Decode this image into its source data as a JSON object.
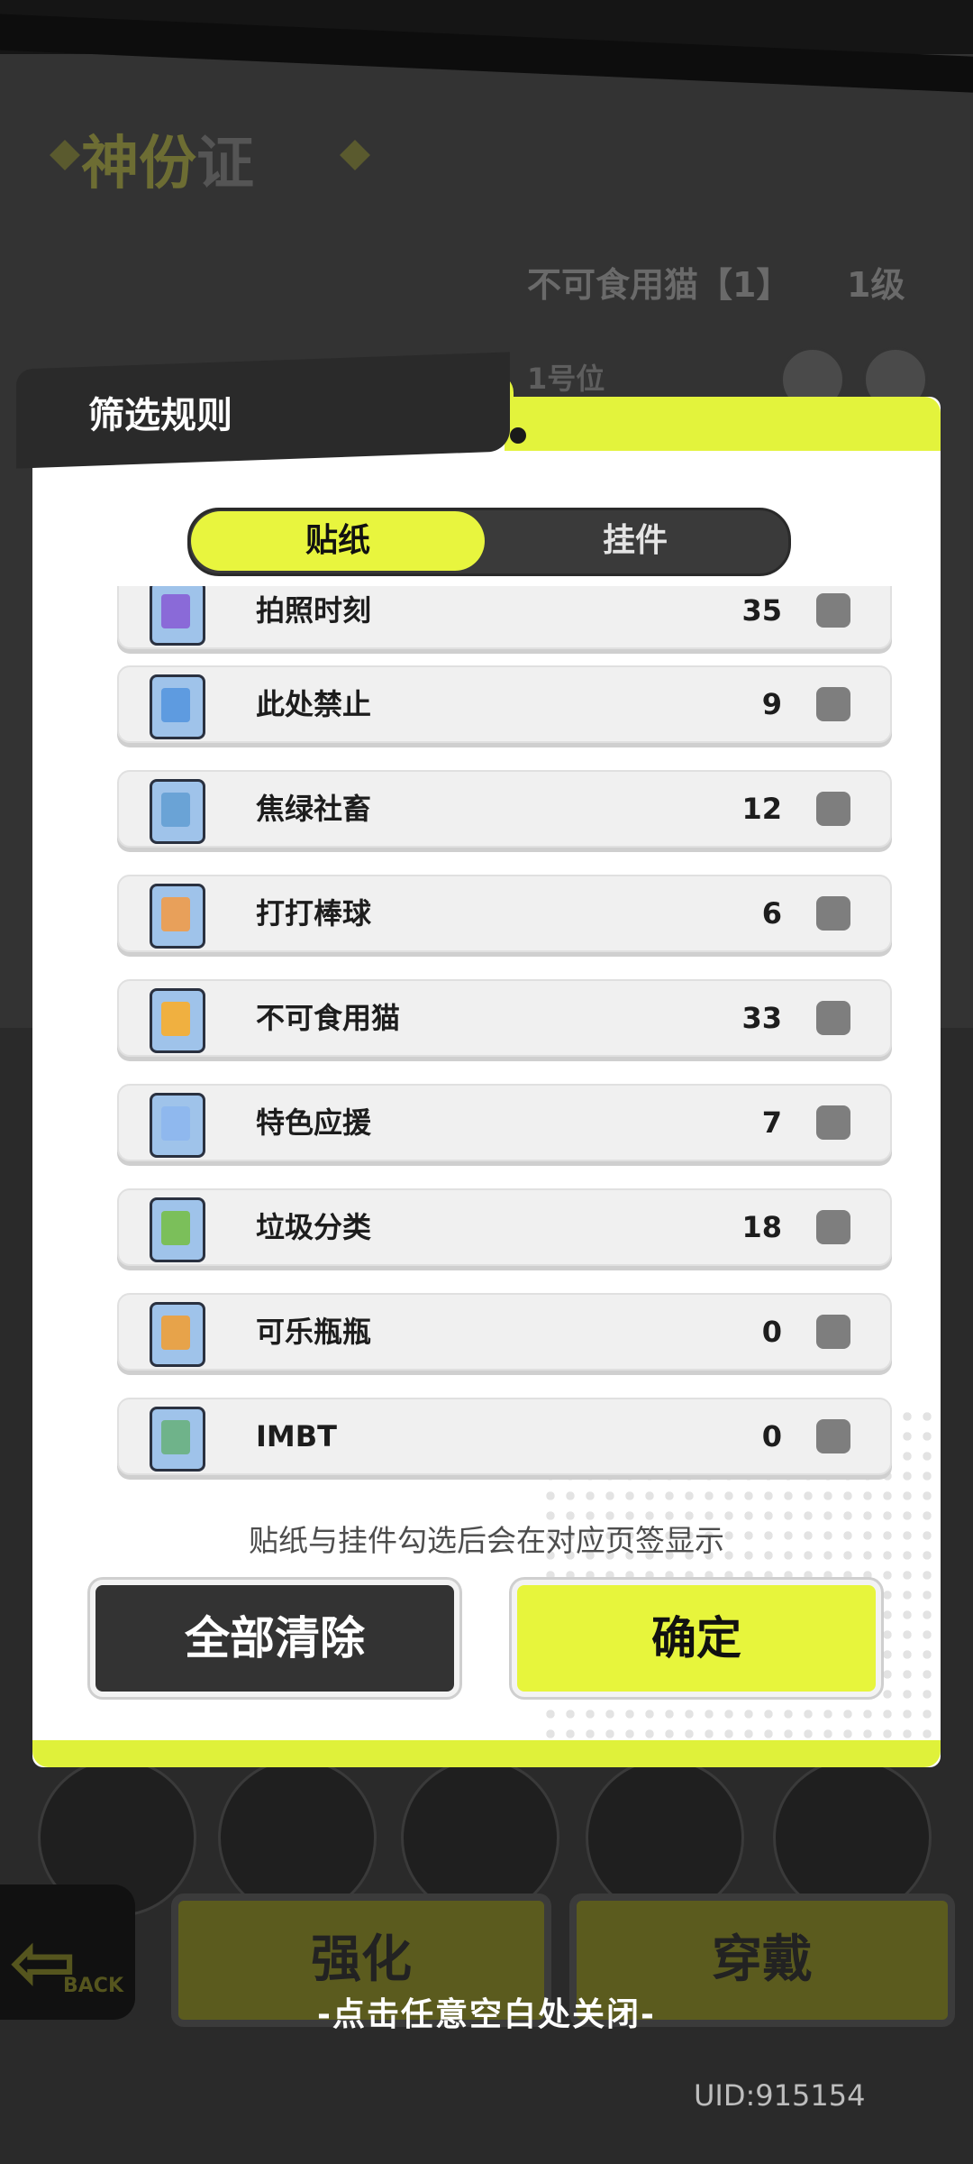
{
  "background": {
    "title_part1": "神份",
    "title_part2": "证",
    "character_name": "不可食用猫【1】",
    "level": "1级",
    "slot": "1号位",
    "back_label": "BACK",
    "enhance_button": "强化",
    "wear_button": "穿戴"
  },
  "modal": {
    "title": "筛选规则",
    "tabs": [
      {
        "label": "贴纸",
        "active": true
      },
      {
        "label": "挂件",
        "active": false
      }
    ],
    "items": [
      {
        "name": "拍照时刻",
        "count": "35",
        "icon_color": "#8a6ad8"
      },
      {
        "name": "此处禁止",
        "count": "9",
        "icon_color": "#5e9be0"
      },
      {
        "name": "焦绿社畜",
        "count": "12",
        "icon_color": "#6aa3d6"
      },
      {
        "name": "打打棒球",
        "count": "6",
        "icon_color": "#e8a05a"
      },
      {
        "name": "不可食用猫",
        "count": "33",
        "icon_color": "#f0b040"
      },
      {
        "name": "特色应援",
        "count": "7",
        "icon_color": "#8fb8ee"
      },
      {
        "name": "垃圾分类",
        "count": "18",
        "icon_color": "#7bbf5a"
      },
      {
        "name": "可乐瓶瓶",
        "count": "0",
        "icon_color": "#e7a34a"
      },
      {
        "name": "IMBT",
        "count": "0",
        "icon_color": "#6fb38a"
      }
    ],
    "hint": "贴纸与挂件勾选后会在对应页签显示",
    "clear_button": "全部清除",
    "confirm_button": "确定"
  },
  "close_hint": "-点击任意空白处关闭-",
  "uid": "UID:915154",
  "colors": {
    "accent": "#e8f53e",
    "dark": "#333333"
  }
}
